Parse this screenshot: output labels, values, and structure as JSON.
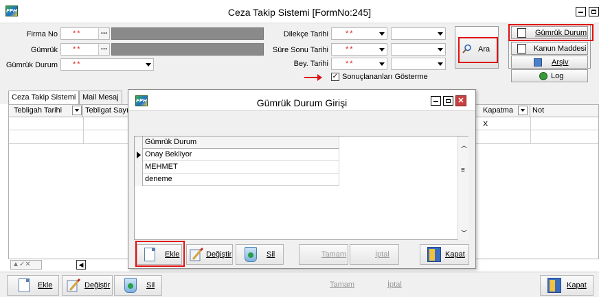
{
  "window": {
    "title": "Ceza Takip Sistemi [FormNo:245]",
    "icon_label": "FPH"
  },
  "form": {
    "firma_no_label": "Firma No",
    "gumruk_label": "Gümrük",
    "gumruk_durum_label": "Gümrük Durum",
    "required_marker": "**",
    "dots_label": "...",
    "dilekce_tarihi_label": "Dilekçe Tarihi",
    "sure_sonu_tarihi_label": "Süre Sonu Tarihi",
    "bey_tarihi_label": "Bey. Tarihi",
    "sonuclananlar_label": "Sonuçlananları Gösterme",
    "sonuclananlar_checked": true,
    "ara_label": "Ara"
  },
  "side_buttons": {
    "gumruk_durum": "Gümrük Durum",
    "kanun_maddesi": "Kanun Maddesi",
    "arsiv": "Arşiv",
    "log": "Log"
  },
  "tabs": [
    {
      "label": "Ceza Takip Sistemi"
    },
    {
      "label": "Mail Mesaj"
    }
  ],
  "grid": {
    "columns": [
      "Tebligah Tarihi",
      "Tebligat Sayı",
      "Kapatma",
      "Not"
    ],
    "row1_kapatma": "X"
  },
  "dialog": {
    "title": "Gümrük Durum Girişi",
    "icon_label": "FPH",
    "column": "Gümrük Durum",
    "rows": [
      "Onay Bekliyor",
      "MEHMET",
      "deneme"
    ],
    "buttons": {
      "ekle": "Ekle",
      "degistir": "Değiştir",
      "sil": "Sil",
      "tamam": "Tamam",
      "iptal": "İptal",
      "kapat": "Kapat"
    }
  },
  "bottom_toolbar": {
    "ekle": "Ekle",
    "degistir": "Değiştir",
    "sil": "Sil",
    "tamam": "Tamam",
    "iptal": "İptal",
    "kapat": "Kapat"
  },
  "colors": {
    "highlight": "#e01010",
    "required": "#e02020"
  }
}
